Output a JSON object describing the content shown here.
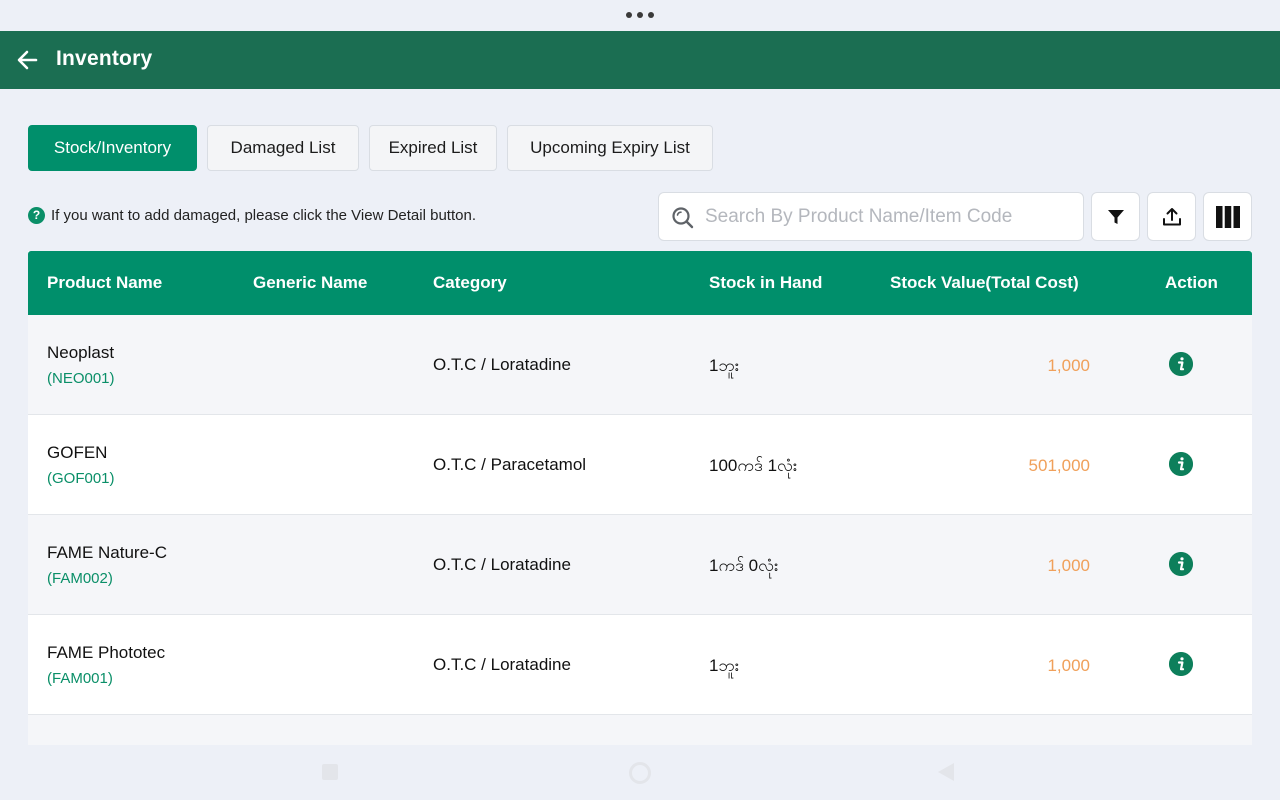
{
  "app_bar": {
    "title": "Inventory",
    "back_icon": "arrow-left-icon",
    "color": "#1b6e52"
  },
  "tabs": [
    {
      "label": "Stock/Inventory",
      "active": true
    },
    {
      "label": "Damaged List",
      "active": false
    },
    {
      "label": "Expired List",
      "active": false
    },
    {
      "label": "Upcoming Expiry List",
      "active": false
    }
  ],
  "hint": {
    "icon": "question-icon",
    "text": "If you want to add damaged, please click the View Detail button."
  },
  "search": {
    "placeholder": "Search By Product Name/Item Code",
    "value": ""
  },
  "toolbar": {
    "filter_icon": "filter-icon",
    "export_icon": "upload-icon",
    "columns_icon": "columns-icon"
  },
  "table": {
    "headers": {
      "product_name": "Product Name",
      "generic_name": "Generic Name",
      "category": "Category",
      "stock_in_hand": "Stock in Hand",
      "stock_value": "Stock Value(Total Cost)",
      "action": "Action"
    },
    "rows": [
      {
        "name": "Neoplast",
        "code": "(NEO001)",
        "generic": "",
        "category": "O.T.C / Loratadine",
        "stock": "1ဘူး",
        "value": "1,000"
      },
      {
        "name": "GOFEN",
        "code": "(GOF001)",
        "generic": "",
        "category": "O.T.C / Paracetamol",
        "stock": "100ကဒ် 1လုံး",
        "value": "501,000"
      },
      {
        "name": "FAME Nature-C",
        "code": "(FAM002)",
        "generic": "",
        "category": "O.T.C / Loratadine",
        "stock": "1ကဒ် 0လုံး",
        "value": "1,000"
      },
      {
        "name": "FAME Phototec",
        "code": "(FAM001)",
        "generic": "",
        "category": "O.T.C / Loratadine",
        "stock": "1ဘူး",
        "value": "1,000"
      }
    ]
  },
  "colors": {
    "accent": "#008f6b",
    "value_text": "#f0a05a",
    "background": "#edf0f7"
  }
}
